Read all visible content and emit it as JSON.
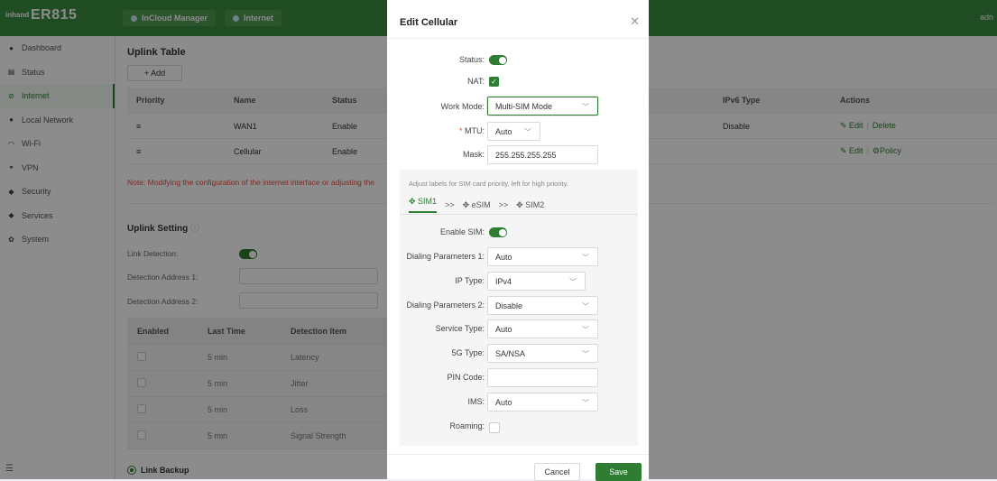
{
  "brand": {
    "logo_small": "inhand",
    "name": "ER815"
  },
  "topnav": [
    {
      "label": "InCloud Manager"
    },
    {
      "label": "Internet"
    }
  ],
  "user": "adn",
  "sidebar": [
    {
      "label": "Dashboard",
      "icon": "dashboard-icon"
    },
    {
      "label": "Status",
      "icon": "status-icon"
    },
    {
      "label": "Internet",
      "icon": "internet-icon",
      "active": true
    },
    {
      "label": "Local Network",
      "icon": "local-network-icon"
    },
    {
      "label": "Wi-Fi",
      "icon": "wifi-icon"
    },
    {
      "label": "VPN",
      "icon": "vpn-icon"
    },
    {
      "label": "Security",
      "icon": "security-icon"
    },
    {
      "label": "Services",
      "icon": "services-icon"
    },
    {
      "label": "System",
      "icon": "system-icon"
    }
  ],
  "uplink": {
    "title": "Uplink Table",
    "add": "+ Add",
    "headers": {
      "priority": "Priority",
      "name": "Name",
      "status": "Status",
      "ipv6": "IPv6 Type",
      "actions": "Actions"
    },
    "rows": [
      {
        "priority_icon": "≡",
        "name": "WAN1",
        "status": "Enable",
        "ipv6": "Disable",
        "edit": "Edit",
        "other": "Delete"
      },
      {
        "priority_icon": "≡",
        "name": "Cellular",
        "status": "Enable",
        "ipv6": "",
        "edit": "Edit",
        "other": "Policy"
      }
    ],
    "note": "Note: Modifying the configuration of the internet interface or adjusting the"
  },
  "setting": {
    "title": "Uplink Setting",
    "link_detection": "Link Detection:",
    "addr1": "Detection Address 1:",
    "addr2": "Detection Address 2:",
    "headers": {
      "enabled": "Enabled",
      "last_time": "Last Time",
      "item": "Detection Item"
    },
    "rows": [
      {
        "time": "5 min",
        "item": "Latency"
      },
      {
        "time": "5 min",
        "item": "Jitter"
      },
      {
        "time": "5 min",
        "item": "Loss"
      },
      {
        "time": "5 min",
        "item": "Signal Strength"
      }
    ],
    "link_backup": "Link Backup"
  },
  "modal": {
    "title": "Edit Cellular",
    "status": "Status:",
    "nat": "NAT:",
    "work_mode_label": "Work Mode:",
    "work_mode": "Multi-SIM Mode",
    "mtu_label": "MTU:",
    "mtu": "Auto",
    "mask_label": "Mask:",
    "mask": "255.255.255.255",
    "sim_hint": "Adjust labels for SIM card priority, left for high priority.",
    "sim_tabs": [
      "SIM1",
      "eSIM",
      "SIM2"
    ],
    "arrow": ">>",
    "enable_sim": "Enable SIM:",
    "dial1_label": "Dialing Parameters 1:",
    "dial1": "Auto",
    "ip_type_label": "IP Type:",
    "ip_type": "IPv4",
    "dial2_label": "Dialing Parameters 2:",
    "dial2": "Disable",
    "service_label": "Service Type:",
    "service": "Auto",
    "g5_label": "5G Type:",
    "g5": "SA/NSA",
    "pin_label": "PIN Code:",
    "ims_label": "IMS:",
    "ims": "Auto",
    "roaming_label": "Roaming:",
    "cancel": "Cancel",
    "save": "Save"
  }
}
